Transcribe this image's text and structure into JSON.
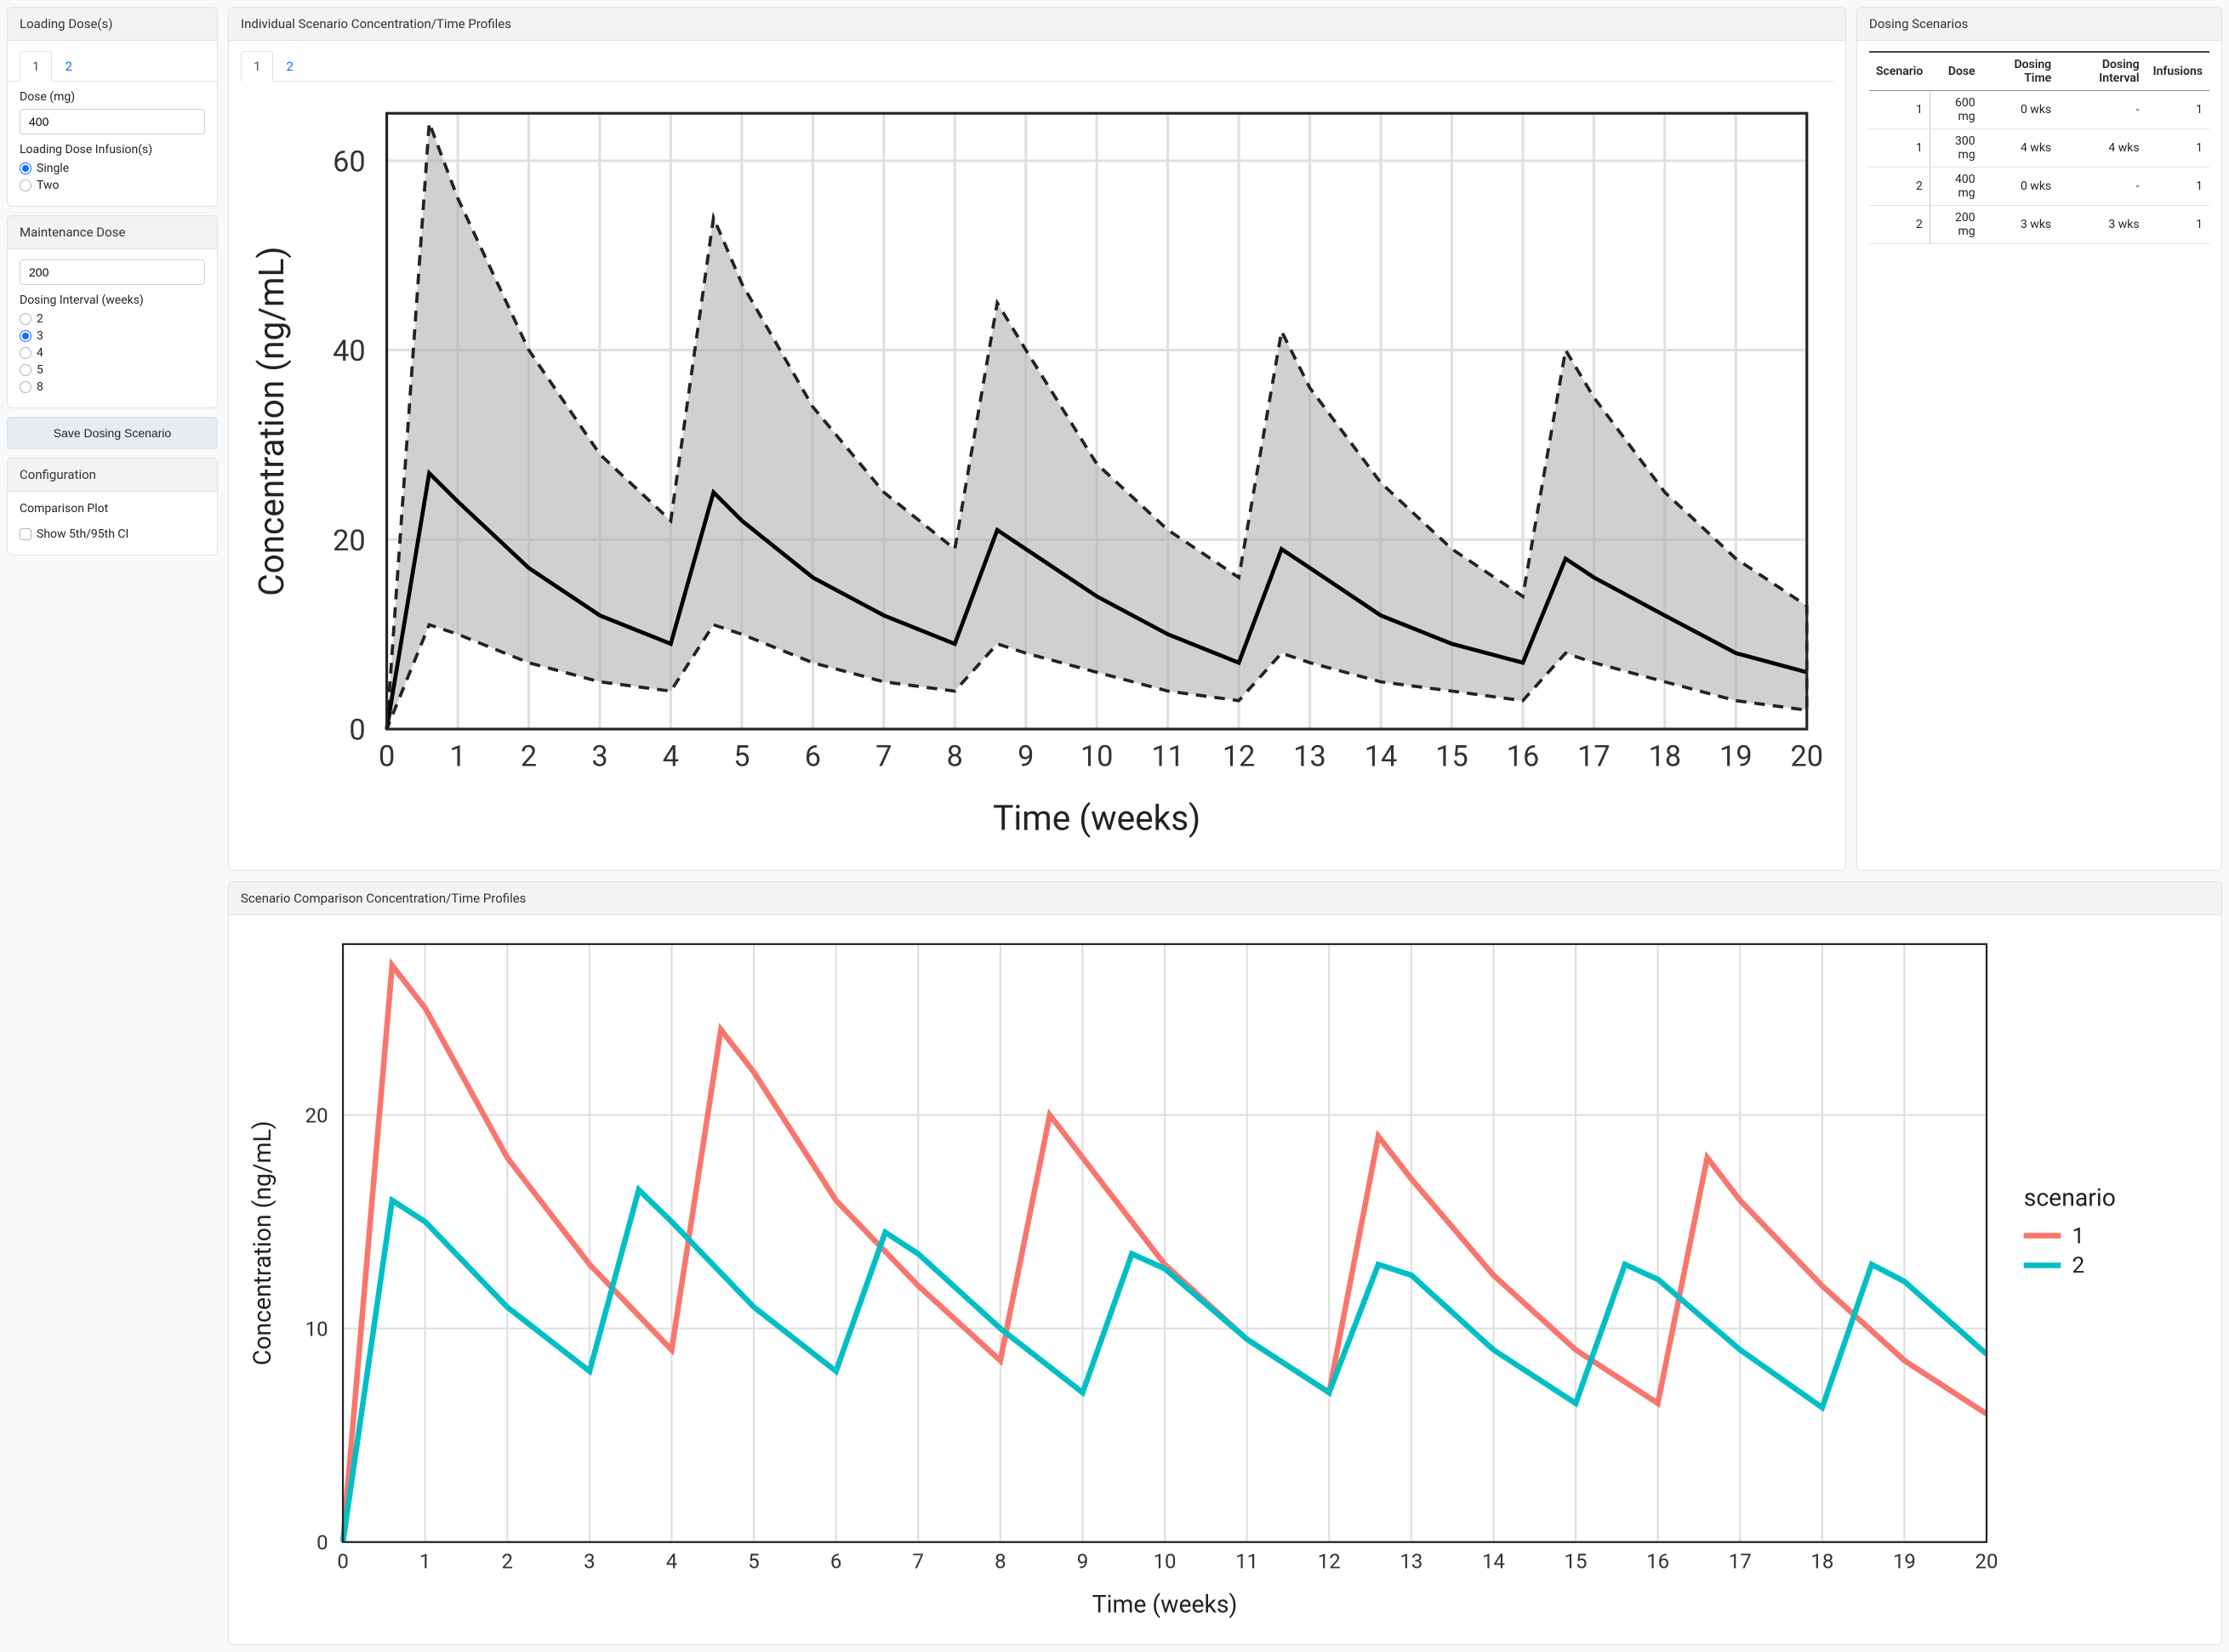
{
  "sidebar": {
    "loading": {
      "title": "Loading Dose(s)",
      "tabs": [
        "1",
        "2"
      ],
      "active_tab": 0,
      "dose_label": "Dose (mg)",
      "dose_value": "400",
      "infusion_label": "Loading Dose Infusion(s)",
      "infusion_options": [
        "Single",
        "Two"
      ],
      "infusion_selected": 0
    },
    "maintenance": {
      "title": "Maintenance Dose",
      "dose_value": "200",
      "interval_label": "Dosing Interval (weeks)",
      "interval_options": [
        "2",
        "3",
        "4",
        "5",
        "8"
      ],
      "interval_selected": 1
    },
    "save_label": "Save Dosing Scenario",
    "config": {
      "title": "Configuration",
      "section_label": "Comparison Plot",
      "ci_label": "Show 5th/95th CI",
      "ci_checked": false
    }
  },
  "individual_chart": {
    "title": "Individual Scenario Concentration/Time Profiles",
    "tabs": [
      "1",
      "2"
    ],
    "active_tab": 0
  },
  "scenarios": {
    "title": "Dosing Scenarios",
    "headers": [
      "Scenario",
      "Dose",
      "Dosing Time",
      "Dosing Interval",
      "Infusions"
    ],
    "rows": [
      {
        "scenario": "1",
        "dose": "600 mg",
        "time": "0 wks",
        "interval": "-",
        "infusions": "1"
      },
      {
        "scenario": "1",
        "dose": "300 mg",
        "time": "4 wks",
        "interval": "4 wks",
        "infusions": "1"
      },
      {
        "scenario": "2",
        "dose": "400 mg",
        "time": "0 wks",
        "interval": "-",
        "infusions": "1"
      },
      {
        "scenario": "2",
        "dose": "200 mg",
        "time": "3 wks",
        "interval": "3 wks",
        "infusions": "1"
      }
    ]
  },
  "comparison_chart": {
    "title": "Scenario Comparison Concentration/Time Profiles",
    "legend_title": "scenario",
    "legend_items": [
      "1",
      "2"
    ]
  },
  "chart_data": [
    {
      "type": "area",
      "title": "Individual Scenario Concentration/Time Profiles",
      "xlabel": "Time (weeks)",
      "ylabel": "Concentration (ng/mL)",
      "xlim": [
        0,
        20
      ],
      "ylim": [
        0,
        65
      ],
      "x_ticks": [
        0,
        1,
        2,
        3,
        4,
        5,
        6,
        7,
        8,
        9,
        10,
        11,
        12,
        13,
        14,
        15,
        16,
        17,
        18,
        19,
        20
      ],
      "y_ticks": [
        0,
        20,
        40,
        60
      ],
      "series": [
        {
          "name": "upper95",
          "x": [
            0,
            0.6,
            1,
            2,
            3,
            4,
            4.6,
            5,
            6,
            7,
            8,
            8.6,
            9,
            10,
            11,
            12,
            12.6,
            13,
            14,
            15,
            16,
            16.6,
            17,
            18,
            19,
            20
          ],
          "values": [
            0,
            64,
            56,
            40,
            29,
            22,
            54,
            47,
            34,
            25,
            19,
            45,
            40,
            28,
            21,
            16,
            42,
            36,
            26,
            19,
            14,
            40,
            35,
            25,
            18,
            13
          ]
        },
        {
          "name": "median",
          "x": [
            0,
            0.6,
            1,
            2,
            3,
            4,
            4.6,
            5,
            6,
            7,
            8,
            8.6,
            9,
            10,
            11,
            12,
            12.6,
            13,
            14,
            15,
            16,
            16.6,
            17,
            18,
            19,
            20
          ],
          "values": [
            0,
            27,
            24,
            17,
            12,
            9,
            25,
            22,
            16,
            12,
            9,
            21,
            19,
            14,
            10,
            7,
            19,
            17,
            12,
            9,
            7,
            18,
            16,
            12,
            8,
            6
          ]
        },
        {
          "name": "lower5",
          "x": [
            0,
            0.6,
            1,
            2,
            3,
            4,
            4.6,
            5,
            6,
            7,
            8,
            8.6,
            9,
            10,
            11,
            12,
            12.6,
            13,
            14,
            15,
            16,
            16.6,
            17,
            18,
            19,
            20
          ],
          "values": [
            0,
            11,
            10,
            7,
            5,
            4,
            11,
            10,
            7,
            5,
            4,
            9,
            8,
            6,
            4,
            3,
            8,
            7,
            5,
            4,
            3,
            8,
            7,
            5,
            3,
            2
          ]
        }
      ]
    },
    {
      "type": "line",
      "title": "Scenario Comparison Concentration/Time Profiles",
      "xlabel": "Time (weeks)",
      "ylabel": "Concentration (ng/mL)",
      "xlim": [
        0,
        20
      ],
      "ylim": [
        0,
        28
      ],
      "x_ticks": [
        0,
        1,
        2,
        3,
        4,
        5,
        6,
        7,
        8,
        9,
        10,
        11,
        12,
        13,
        14,
        15,
        16,
        17,
        18,
        19,
        20
      ],
      "y_ticks": [
        0,
        10,
        20
      ],
      "legend_title": "scenario",
      "series": [
        {
          "name": "1",
          "color": "#f8766d",
          "x": [
            0,
            0.6,
            1,
            2,
            3,
            4,
            4.6,
            5,
            6,
            7,
            8,
            8.6,
            9,
            10,
            11,
            12,
            12.6,
            13,
            14,
            15,
            16,
            16.6,
            17,
            18,
            19,
            20
          ],
          "values": [
            0,
            27,
            25,
            18,
            13,
            9,
            24,
            22,
            16,
            12,
            8.5,
            20,
            18,
            13,
            9.5,
            7,
            19,
            17,
            12.5,
            9,
            6.5,
            18,
            16,
            12,
            8.5,
            6
          ]
        },
        {
          "name": "2",
          "color": "#00bfc4",
          "x": [
            0,
            0.6,
            1,
            2,
            3,
            3.6,
            4,
            5,
            6,
            6.6,
            7,
            8,
            9,
            9.6,
            10,
            11,
            12,
            12.6,
            13,
            14,
            15,
            15.6,
            16,
            17,
            18,
            18.6,
            19,
            20
          ],
          "values": [
            0,
            16,
            15,
            11,
            8,
            16.5,
            15,
            11,
            8,
            14.5,
            13.5,
            10,
            7,
            13.5,
            12.8,
            9.5,
            7,
            13,
            12.5,
            9,
            6.5,
            13,
            12.3,
            9,
            6.3,
            13,
            12.2,
            8.8
          ]
        }
      ]
    }
  ]
}
